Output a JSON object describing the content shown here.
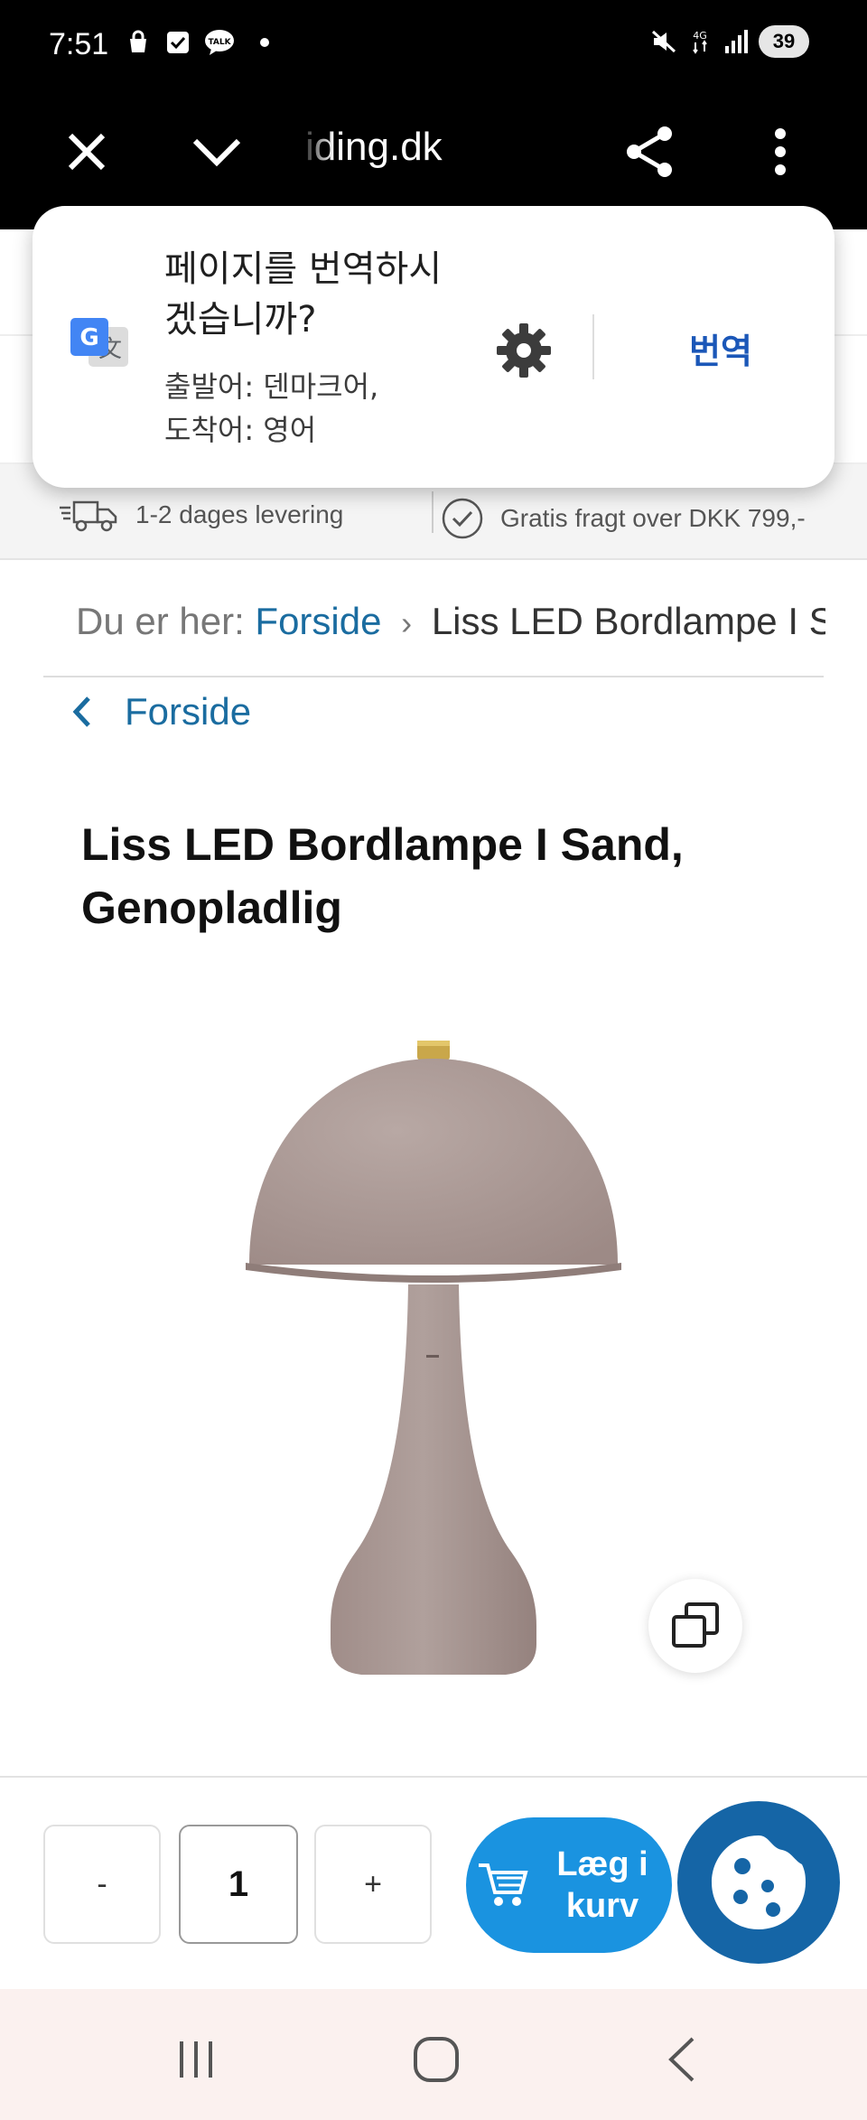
{
  "status_bar": {
    "time": "7:51",
    "battery": "39",
    "network": "4G",
    "icons_left": [
      "shopping-bag-icon",
      "checkbox-icon",
      "talk-icon"
    ],
    "icons_right": [
      "mute-icon",
      "network-icon",
      "signal-icon"
    ]
  },
  "browser": {
    "url": "iding.dk"
  },
  "translate_popup": {
    "title": "페이지를 번역하시겠습니까?",
    "source_lang": "출발어: 덴마크어,",
    "target_lang": "도착어: 영어",
    "translate_button": "번역"
  },
  "shipping": {
    "delivery": "1-2 dages levering",
    "free_shipping": "Gratis fragt over DKK 799,-"
  },
  "breadcrumb": {
    "prefix": "Du er her:",
    "home": "Forside",
    "separator": "›",
    "current": "Liss LED Bordlampe I Sand, Genopladlig"
  },
  "back_link": {
    "label": "Forside"
  },
  "product": {
    "title": "Liss LED Bordlampe I Sand, Genopladlig",
    "lamp_color": "#a69390"
  },
  "cart": {
    "minus": "-",
    "quantity": "1",
    "plus": "+",
    "add_to_cart": "Læg i kurv"
  },
  "colors": {
    "accent_blue": "#1a93e0",
    "cookie_blue": "#1565a6",
    "link_blue": "#1a6ca0",
    "translate_blue": "#1b57b8"
  }
}
